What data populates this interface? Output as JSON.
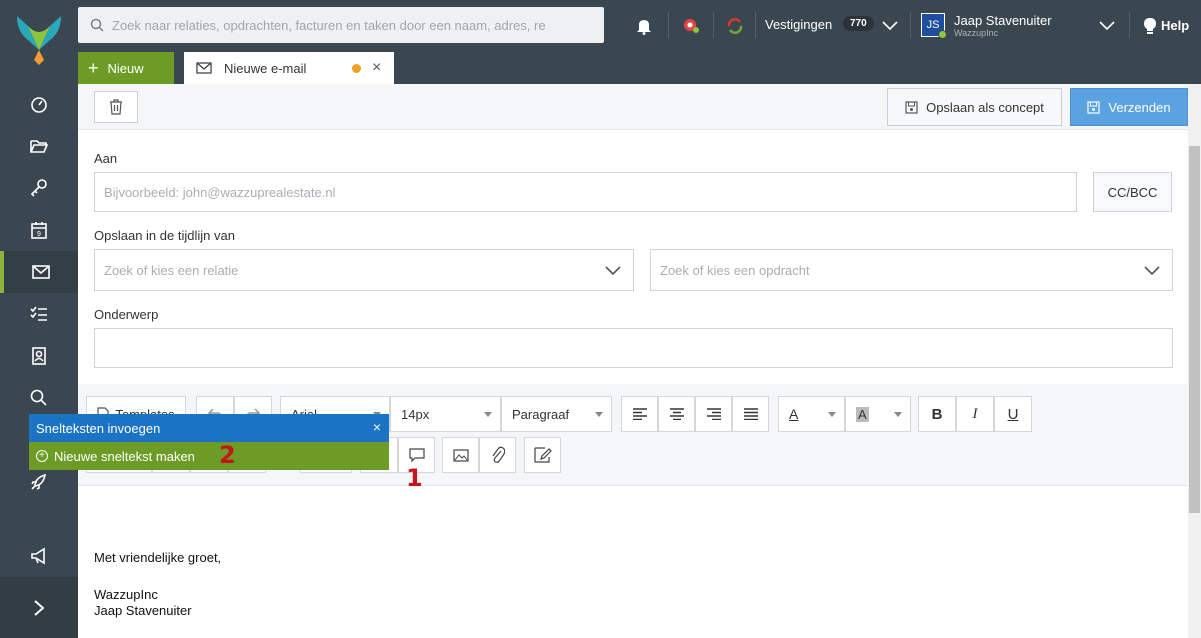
{
  "topbar": {
    "search_placeholder": "Zoek naar relaties, opdrachten, facturen en taken door een naam, adres, re",
    "branches_label": "Vestigingen",
    "branches_count": "770",
    "user_initials": "JS",
    "user_name": "Jaap Stavenuiter",
    "user_company": "WazzupInc",
    "help_label": "Help"
  },
  "tabs": {
    "new_label": "Nieuw",
    "email_tab_label": "Nieuwe e-mail"
  },
  "actions": {
    "save_draft_label": "Opslaan als concept",
    "send_label": "Verzenden"
  },
  "form": {
    "to_label": "Aan",
    "to_placeholder": "Bijvoorbeeld: john@wazzuprealestate.nl",
    "ccbcc_label": "CC/BCC",
    "timeline_label": "Opslaan in de tijdlijn van",
    "relation_placeholder": "Zoek of kies een relatie",
    "assignment_placeholder": "Zoek of kies een opdracht",
    "subject_label": "Onderwerp",
    "subject_value": ""
  },
  "toolbar": {
    "templates_label": "Templates",
    "font_value": "Arial",
    "size_value": "14px",
    "block_value": "Paragraaf",
    "color_letter": "A",
    "bg_letter": "A",
    "bold": "B",
    "italic": "I",
    "underline": "U"
  },
  "snippets": {
    "title": "Snelteksten invoegen",
    "new_label": "Nieuwe sneltekst maken",
    "close": "×"
  },
  "markers": {
    "one": "1",
    "two": "2"
  },
  "editor": {
    "greeting": "Met vriendelijke groet,",
    "company": "WazzupInc",
    "name": "Jaap Stavenuiter"
  },
  "colors": {
    "sidebar": "#3b4750",
    "accent_green": "#6c9c26",
    "send_blue": "#5aa3e0",
    "popup_blue": "#1b73c4",
    "marker_red": "#c4161c"
  }
}
